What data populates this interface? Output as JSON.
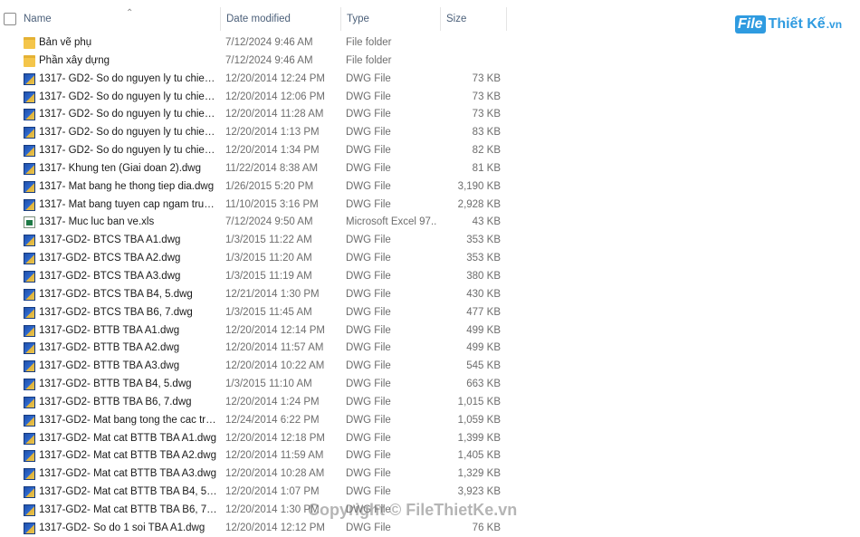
{
  "header": {
    "name": "Name",
    "date_modified": "Date modified",
    "type": "Type",
    "size": "Size"
  },
  "logo": {
    "file": "File",
    "rest": "Thiết Kế",
    "vn": ".vn"
  },
  "watermark": "Copyright © FileThietKe.vn",
  "rows": [
    {
      "icon": "folder-icon",
      "name": "Bản vẽ phụ",
      "date": "7/12/2024 9:46 AM",
      "type": "File folder",
      "size": ""
    },
    {
      "icon": "folder-icon",
      "name": "Phần xây dựng",
      "date": "7/12/2024 9:46 AM",
      "type": "File folder",
      "size": ""
    },
    {
      "icon": "dwg-icon",
      "name": "1317- GD2- So do nguyen ly tu chieu s...",
      "date": "12/20/2014 12:24 PM",
      "type": "DWG File",
      "size": "73 KB"
    },
    {
      "icon": "dwg-icon",
      "name": "1317- GD2- So do nguyen ly tu chieu s...",
      "date": "12/20/2014 12:06 PM",
      "type": "DWG File",
      "size": "73 KB"
    },
    {
      "icon": "dwg-icon",
      "name": "1317- GD2- So do nguyen ly tu chieu s...",
      "date": "12/20/2014 11:28 AM",
      "type": "DWG File",
      "size": "73 KB"
    },
    {
      "icon": "dwg-icon",
      "name": "1317- GD2- So do nguyen ly tu chieu s...",
      "date": "12/20/2014 1:13 PM",
      "type": "DWG File",
      "size": "83 KB"
    },
    {
      "icon": "dwg-icon",
      "name": "1317- GD2- So do nguyen ly tu chieu s...",
      "date": "12/20/2014 1:34 PM",
      "type": "DWG File",
      "size": "82 KB"
    },
    {
      "icon": "dwg-icon",
      "name": "1317- Khung ten (Giai doan 2).dwg",
      "date": "11/22/2014 8:38 AM",
      "type": "DWG File",
      "size": "81 KB"
    },
    {
      "icon": "dwg-icon",
      "name": "1317- Mat bang he thong tiep dia.dwg",
      "date": "1/26/2015 5:20 PM",
      "type": "DWG File",
      "size": "3,190 KB"
    },
    {
      "icon": "dwg-icon",
      "name": "1317- Mat bang tuyen cap ngam trun...",
      "date": "11/10/2015 3:16 PM",
      "type": "DWG File",
      "size": "2,928 KB"
    },
    {
      "icon": "xls-icon",
      "name": "1317- Muc luc ban ve.xls",
      "date": "7/12/2024 9:50 AM",
      "type": "Microsoft Excel 97...",
      "size": "43 KB"
    },
    {
      "icon": "dwg-icon",
      "name": "1317-GD2- BTCS TBA A1.dwg",
      "date": "1/3/2015 11:22 AM",
      "type": "DWG File",
      "size": "353 KB"
    },
    {
      "icon": "dwg-icon",
      "name": "1317-GD2- BTCS TBA A2.dwg",
      "date": "1/3/2015 11:20 AM",
      "type": "DWG File",
      "size": "353 KB"
    },
    {
      "icon": "dwg-icon",
      "name": "1317-GD2- BTCS TBA A3.dwg",
      "date": "1/3/2015 11:19 AM",
      "type": "DWG File",
      "size": "380 KB"
    },
    {
      "icon": "dwg-icon",
      "name": "1317-GD2- BTCS TBA B4, 5.dwg",
      "date": "12/21/2014 1:30 PM",
      "type": "DWG File",
      "size": "430 KB"
    },
    {
      "icon": "dwg-icon",
      "name": "1317-GD2- BTCS TBA B6, 7.dwg",
      "date": "1/3/2015 11:45 AM",
      "type": "DWG File",
      "size": "477 KB"
    },
    {
      "icon": "dwg-icon",
      "name": "1317-GD2- BTTB TBA A1.dwg",
      "date": "12/20/2014 12:14 PM",
      "type": "DWG File",
      "size": "499 KB"
    },
    {
      "icon": "dwg-icon",
      "name": "1317-GD2- BTTB TBA A2.dwg",
      "date": "12/20/2014 11:57 AM",
      "type": "DWG File",
      "size": "499 KB"
    },
    {
      "icon": "dwg-icon",
      "name": "1317-GD2- BTTB TBA A3.dwg",
      "date": "12/20/2014 10:22 AM",
      "type": "DWG File",
      "size": "545 KB"
    },
    {
      "icon": "dwg-icon",
      "name": "1317-GD2- BTTB TBA B4, 5.dwg",
      "date": "1/3/2015 11:10 AM",
      "type": "DWG File",
      "size": "663 KB"
    },
    {
      "icon": "dwg-icon",
      "name": "1317-GD2- BTTB TBA B6, 7.dwg",
      "date": "12/20/2014 1:24 PM",
      "type": "DWG File",
      "size": "1,015 KB"
    },
    {
      "icon": "dwg-icon",
      "name": "1317-GD2- Mat bang tong the cac tra...",
      "date": "12/24/2014 6:22 PM",
      "type": "DWG File",
      "size": "1,059 KB"
    },
    {
      "icon": "dwg-icon",
      "name": "1317-GD2- Mat cat BTTB TBA A1.dwg",
      "date": "12/20/2014 12:18 PM",
      "type": "DWG File",
      "size": "1,399 KB"
    },
    {
      "icon": "dwg-icon",
      "name": "1317-GD2- Mat cat BTTB TBA A2.dwg",
      "date": "12/20/2014 11:59 AM",
      "type": "DWG File",
      "size": "1,405 KB"
    },
    {
      "icon": "dwg-icon",
      "name": "1317-GD2- Mat cat BTTB TBA A3.dwg",
      "date": "12/20/2014 10:28 AM",
      "type": "DWG File",
      "size": "1,329 KB"
    },
    {
      "icon": "dwg-icon",
      "name": "1317-GD2- Mat cat BTTB TBA B4, 5.dwg",
      "date": "12/20/2014 1:07 PM",
      "type": "DWG File",
      "size": "3,923 KB"
    },
    {
      "icon": "dwg-icon",
      "name": "1317-GD2- Mat cat BTTB TBA B6, 7.dwg",
      "date": "12/20/2014 1:30 PM",
      "type": "DWG File",
      "size": ""
    },
    {
      "icon": "dwg-icon",
      "name": "1317-GD2- So do 1 soi TBA A1.dwg",
      "date": "12/20/2014 12:12 PM",
      "type": "DWG File",
      "size": "76 KB"
    }
  ]
}
